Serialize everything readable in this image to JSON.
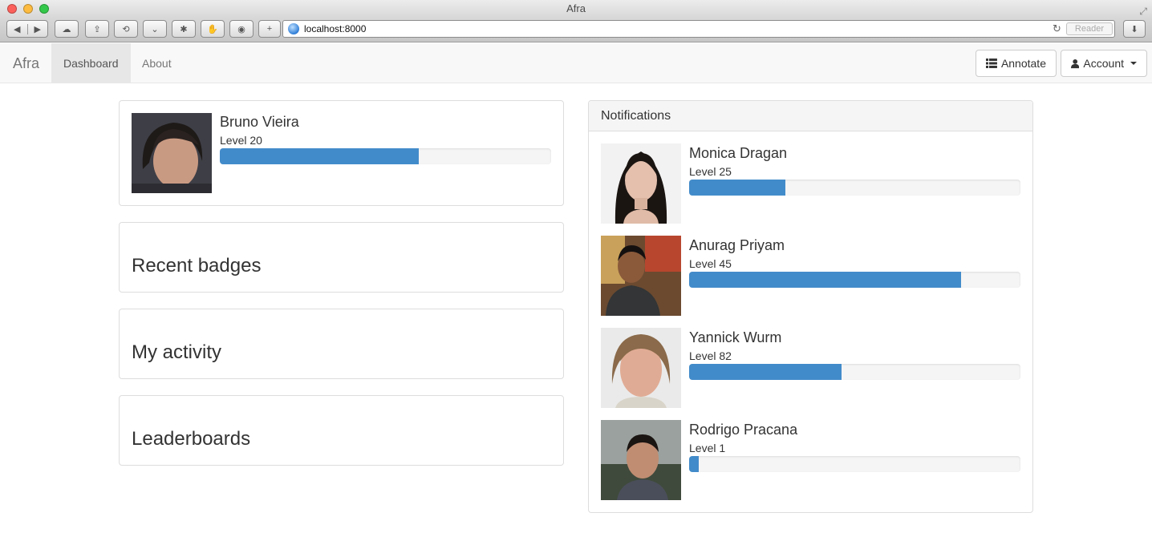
{
  "window": {
    "title": "Afra"
  },
  "browser": {
    "url": "localhost:8000",
    "reader_label": "Reader",
    "toolbar_icons": [
      "back-icon",
      "forward-icon",
      "icloud-icon",
      "share-icon",
      "history-icon",
      "pocket-icon",
      "puzzle-icon",
      "hand-icon",
      "shield-icon",
      "new-tab-icon",
      "reload-icon",
      "download-icon"
    ]
  },
  "navbar": {
    "brand": "Afra",
    "links": [
      {
        "label": "Dashboard",
        "active": true
      },
      {
        "label": "About",
        "active": false
      }
    ],
    "annotate_label": "Annotate",
    "account_label": "Account"
  },
  "profile": {
    "name": "Bruno Vieira",
    "level_text": "Level 20",
    "progress": 0.6
  },
  "sections": {
    "recent_badges": "Recent badges",
    "my_activity": "My activity",
    "leaderboards": "Leaderboards"
  },
  "notifications": {
    "heading": "Notifications",
    "items": [
      {
        "name": "Monica Dragan",
        "level_text": "Level 25",
        "progress": 0.29
      },
      {
        "name": "Anurag Priyam",
        "level_text": "Level 45",
        "progress": 0.82
      },
      {
        "name": "Yannick Wurm",
        "level_text": "Level 82",
        "progress": 0.46
      },
      {
        "name": "Rodrigo Pracana",
        "level_text": "Level 1",
        "progress": 0.03
      }
    ]
  },
  "colors": {
    "progress_fill": "#428bca",
    "progress_track": "#f5f5f5",
    "navbar_bg": "#f8f8f8",
    "active_tab": "#e7e7e7"
  }
}
